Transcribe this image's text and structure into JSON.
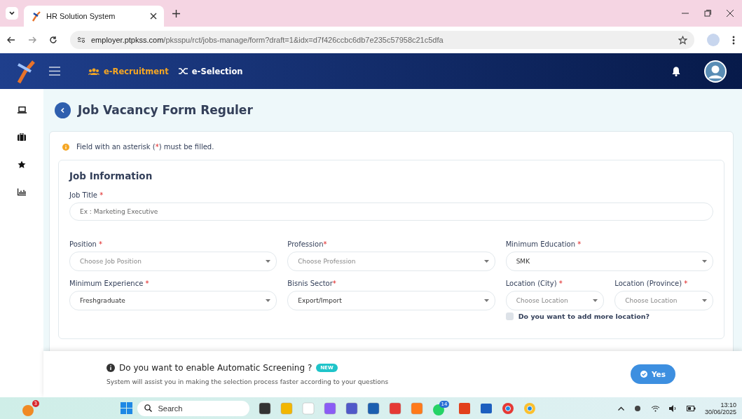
{
  "browser": {
    "tab_title": "HR Solution System",
    "url_host": "employer.ptpkss.com",
    "url_path": "/pksspu/rct/jobs-manage/form?draft=1&idx=d7f426ccbc6db7e235c57958c21c5dfa"
  },
  "nav": {
    "items": [
      {
        "label": "e-Recruitment",
        "selected": true
      },
      {
        "label": "e-Selection",
        "selected": false
      }
    ]
  },
  "page_title": "Job Vacancy Form Reguler",
  "notice": {
    "before": "Field with an asterisk (",
    "mark": "*",
    "after": ") must be filled."
  },
  "section_title": "Job Information",
  "rows": [
    {
      "fields": [
        {
          "kind": "text",
          "label": "Job Title",
          "mark": " *",
          "placeholder": "Ex : Marketing Executive"
        }
      ]
    },
    {
      "fields": [
        {
          "kind": "select",
          "label": "Position",
          "mark": " *",
          "placeholder": "Choose Job Position"
        },
        {
          "kind": "select",
          "label": "Profession",
          "mark": "*",
          "placeholder": "Choose Profession"
        },
        {
          "kind": "select",
          "label": "Minimum Education",
          "mark": " *",
          "value": "SMK"
        }
      ]
    },
    {
      "fields": [
        {
          "kind": "select",
          "label": "Minimum Experience",
          "mark": " *",
          "value": "Freshgraduate"
        },
        {
          "kind": "select",
          "label": "Bisnis Sector",
          "mark": "*",
          "value": "Export/Import"
        },
        {
          "kind": "group",
          "fields": [
            {
              "kind": "select",
              "label": "Location (City)",
              "mark": " *",
              "placeholder": "Choose Location"
            },
            {
              "kind": "select",
              "label": "Location (Province)",
              "mark": " *",
              "placeholder": "Choose Location"
            }
          ],
          "option": {
            "label": "Do you want to add more location?",
            "checked": false
          }
        }
      ]
    }
  ],
  "banner": {
    "title": "Do you want to enable Automatic Screening ?",
    "badge": "NEW",
    "text": "System will assist you in making the selection process faster according to your questions",
    "button": "Yes"
  },
  "taskbar": {
    "weather_badge": "3",
    "search_placeholder": "Search",
    "whatsapp_badge": "14",
    "time": "13:10",
    "date": "30/06/2025"
  }
}
